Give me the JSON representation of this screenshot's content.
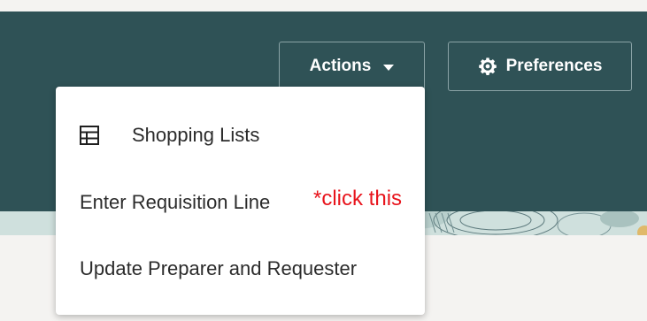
{
  "header": {
    "actions_label": "Actions",
    "preferences_label": "Preferences",
    "background_color": "#2f5256"
  },
  "menu": {
    "items": [
      {
        "label": "Shopping Lists",
        "icon": "table-grid-icon"
      },
      {
        "label": "Enter Requisition Line"
      },
      {
        "label": "Update Preparer and Requester"
      }
    ]
  },
  "annotation": {
    "text": "*click this",
    "color": "#e8141c"
  }
}
